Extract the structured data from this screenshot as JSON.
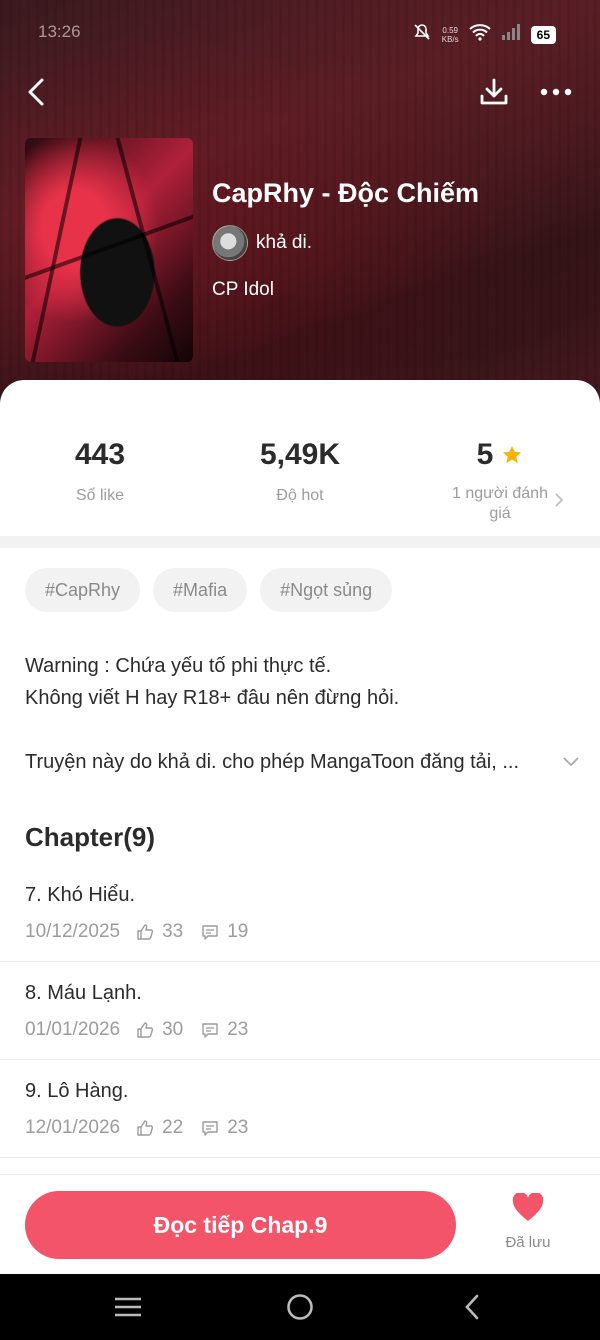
{
  "status_bar": {
    "time": "13:26",
    "net_speed": "0.59",
    "net_unit": "KB/s",
    "battery": "65"
  },
  "book": {
    "title": "CapRhy - Độc Chiếm",
    "author": "khả di.",
    "category": "CP Idol"
  },
  "stats": {
    "likes_value": "443",
    "likes_label": "Số like",
    "hot_value": "5,49K",
    "hot_label": "Độ hot",
    "rating_value": "5",
    "rating_label": "1 người đánh giá"
  },
  "tags": [
    "#CapRhy",
    "#Mafia",
    "#Ngọt sủng"
  ],
  "description": {
    "line1": "Warning : Chứa yếu tố phi thực tế.",
    "line2": "Không viết H hay R18+ đâu nên đừng hỏi.",
    "line3": "Truyện này do khả di. cho phép MangaToon đăng tải, ..."
  },
  "chapters_header": "Chapter(9)",
  "chapters": [
    {
      "title": "7. Khó Hiểu.",
      "date": "10/12/2025",
      "likes": "33",
      "comments": "19"
    },
    {
      "title": "8. Máu Lạnh.",
      "date": "01/01/2026",
      "likes": "30",
      "comments": "23"
    },
    {
      "title": "9. Lô Hàng.",
      "date": "12/01/2026",
      "likes": "22",
      "comments": "23"
    }
  ],
  "actions": {
    "read_label": "Đọc tiếp Chap.9",
    "saved_label": "Đã lưu"
  },
  "colors": {
    "accent": "#f4546a",
    "star": "#f5b400"
  }
}
